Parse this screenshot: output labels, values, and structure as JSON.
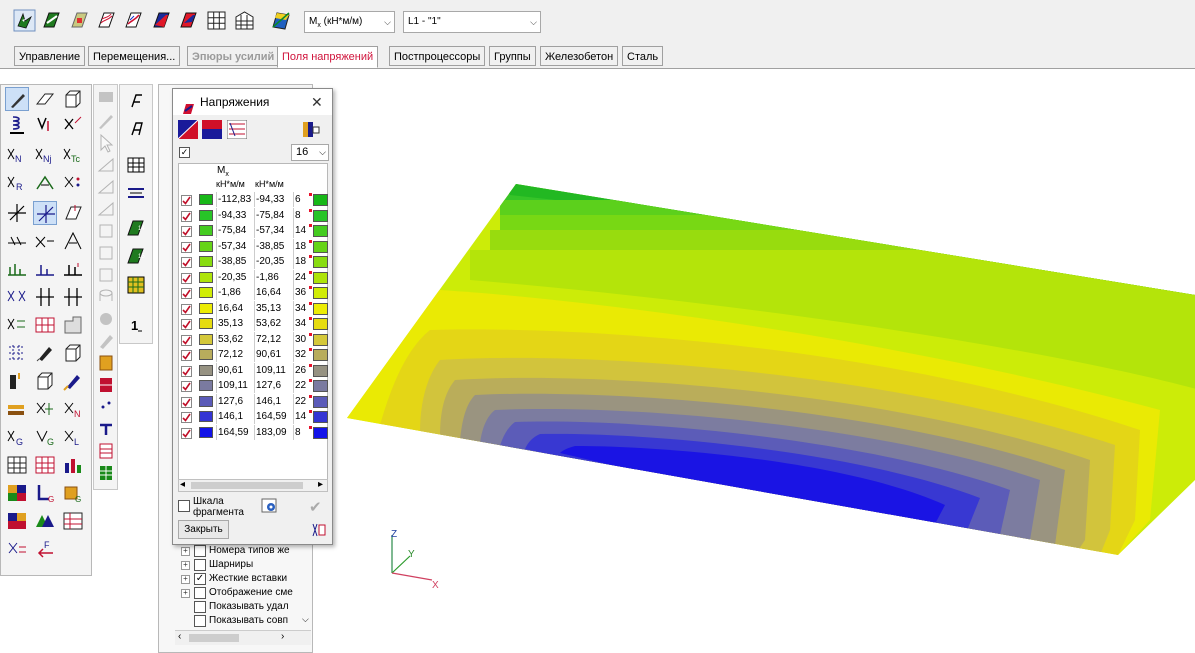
{
  "toolbar": {
    "result_combo": {
      "label": "Mx (кН*м/м)",
      "sub_label": "x"
    },
    "load_combo": {
      "label": "L1 - \"1\""
    }
  },
  "tabs": [
    {
      "label": "Управление",
      "state": "normal"
    },
    {
      "label": "Перемещения...",
      "state": "normal"
    },
    {
      "label": "Эпюры усилий",
      "state": "disabled"
    },
    {
      "label": "Поля напряжений",
      "state": "active"
    },
    {
      "label": "Постпроцессоры",
      "state": "normal"
    },
    {
      "label": "Группы",
      "state": "normal"
    },
    {
      "label": "Железобетон",
      "state": "normal"
    },
    {
      "label": "Сталь",
      "state": "normal"
    }
  ],
  "dialog": {
    "title": "Напряжения",
    "close_icon": "close-icon",
    "levels_value": "16",
    "column_header": {
      "name": "M",
      "sub": "x",
      "unit1": "кН*м/м",
      "unit2": "кН*м/м"
    },
    "rows": [
      {
        "from": "-112,83",
        "to": "-94,33",
        "count": "6",
        "color": "#18b818"
      },
      {
        "from": "-94,33",
        "to": "-75,84",
        "count": "8",
        "color": "#28c428"
      },
      {
        "from": "-75,84",
        "to": "-57,34",
        "count": "14",
        "color": "#44cc20"
      },
      {
        "from": "-57,34",
        "to": "-38,85",
        "count": "18",
        "color": "#66d418"
      },
      {
        "from": "-38,85",
        "to": "-20,35",
        "count": "18",
        "color": "#88dc10"
      },
      {
        "from": "-20,35",
        "to": "-1,86",
        "count": "24",
        "color": "#aee40a"
      },
      {
        "from": "-1,86",
        "to": "16,64",
        "count": "36",
        "color": "#d0ec06"
      },
      {
        "from": "16,64",
        "to": "35,13",
        "count": "34",
        "color": "#ecec04"
      },
      {
        "from": "35,13",
        "to": "53,62",
        "count": "34",
        "color": "#e6dc10"
      },
      {
        "from": "53,62",
        "to": "72,12",
        "count": "30",
        "color": "#d4c83a"
      },
      {
        "from": "72,12",
        "to": "90,61",
        "count": "32",
        "color": "#b8ac5c"
      },
      {
        "from": "90,61",
        "to": "109,11",
        "count": "26",
        "color": "#969282"
      },
      {
        "from": "109,11",
        "to": "127,6",
        "count": "22",
        "color": "#7a7aa0"
      },
      {
        "from": "127,6",
        "to": "146,1",
        "count": "22",
        "color": "#5a5ab8"
      },
      {
        "from": "146,1",
        "to": "164,59",
        "count": "14",
        "color": "#3434d4"
      },
      {
        "from": "164,59",
        "to": "183,09",
        "count": "8",
        "color": "#1212e8"
      }
    ],
    "fragment_scale_label_1": "Шкала",
    "fragment_scale_label_2": "фрагмента",
    "close_button": "Закрыть"
  },
  "tree_items": [
    {
      "label": "Номера типов же",
      "expand": true,
      "checked": false
    },
    {
      "label": "Шарниры",
      "expand": true,
      "checked": false
    },
    {
      "label": "Жесткие вставки",
      "expand": true,
      "checked": true
    },
    {
      "label": "Отображение сме",
      "expand": true,
      "checked": false
    },
    {
      "label": "Показывать удал",
      "expand": false,
      "checked": false
    },
    {
      "label": "Показывать совп",
      "expand": false,
      "checked": false
    }
  ],
  "axes": {
    "z": "Z",
    "y": "Y",
    "x": "X"
  },
  "colors": {
    "accent_active_tab": "#d0143c",
    "bg": "#f0f0f0"
  }
}
